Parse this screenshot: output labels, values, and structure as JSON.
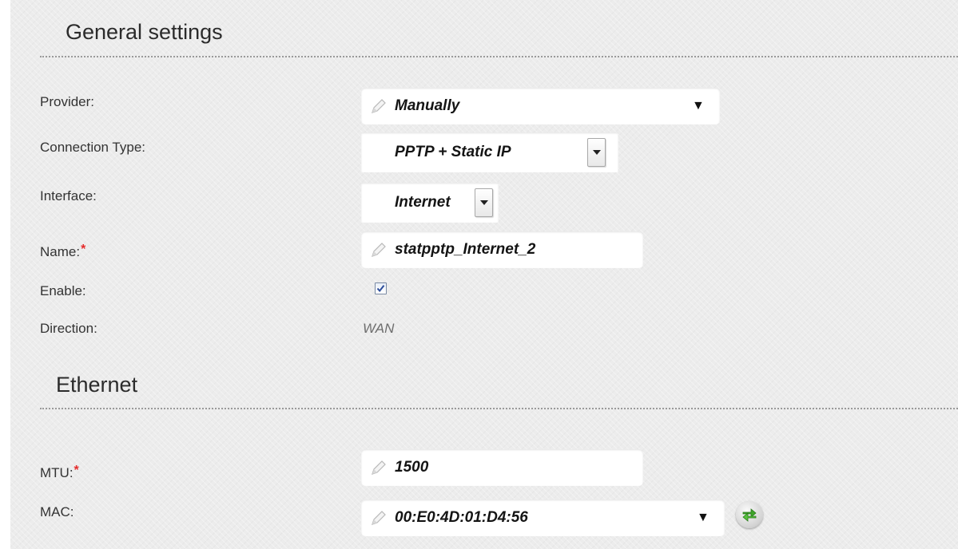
{
  "general_settings": {
    "title": "General settings",
    "provider": {
      "label": "Provider:",
      "value": "Manually",
      "icon": "pencil-icon"
    },
    "connection_type": {
      "label": "Connection Type:",
      "value": "PPTP + Static IP"
    },
    "interface": {
      "label": "Interface:",
      "value": "Internet"
    },
    "name": {
      "label": "Name:",
      "required_mark": "*",
      "value": "statpptp_Internet_2"
    },
    "enable": {
      "label": "Enable:",
      "checked": true
    },
    "direction": {
      "label": "Direction:",
      "value": "WAN"
    }
  },
  "ethernet": {
    "title": "Ethernet",
    "mtu": {
      "label": "MTU:",
      "required_mark": "*",
      "value": "1500"
    },
    "mac": {
      "label": "MAC:",
      "value": "00:E0:4D:01:D4:56",
      "refresh_icon": "refresh-arrows-icon"
    }
  },
  "colors": {
    "background": "#ececec",
    "required_mark": "#e52b2b",
    "refresh_arrows": "#3fa52a"
  }
}
